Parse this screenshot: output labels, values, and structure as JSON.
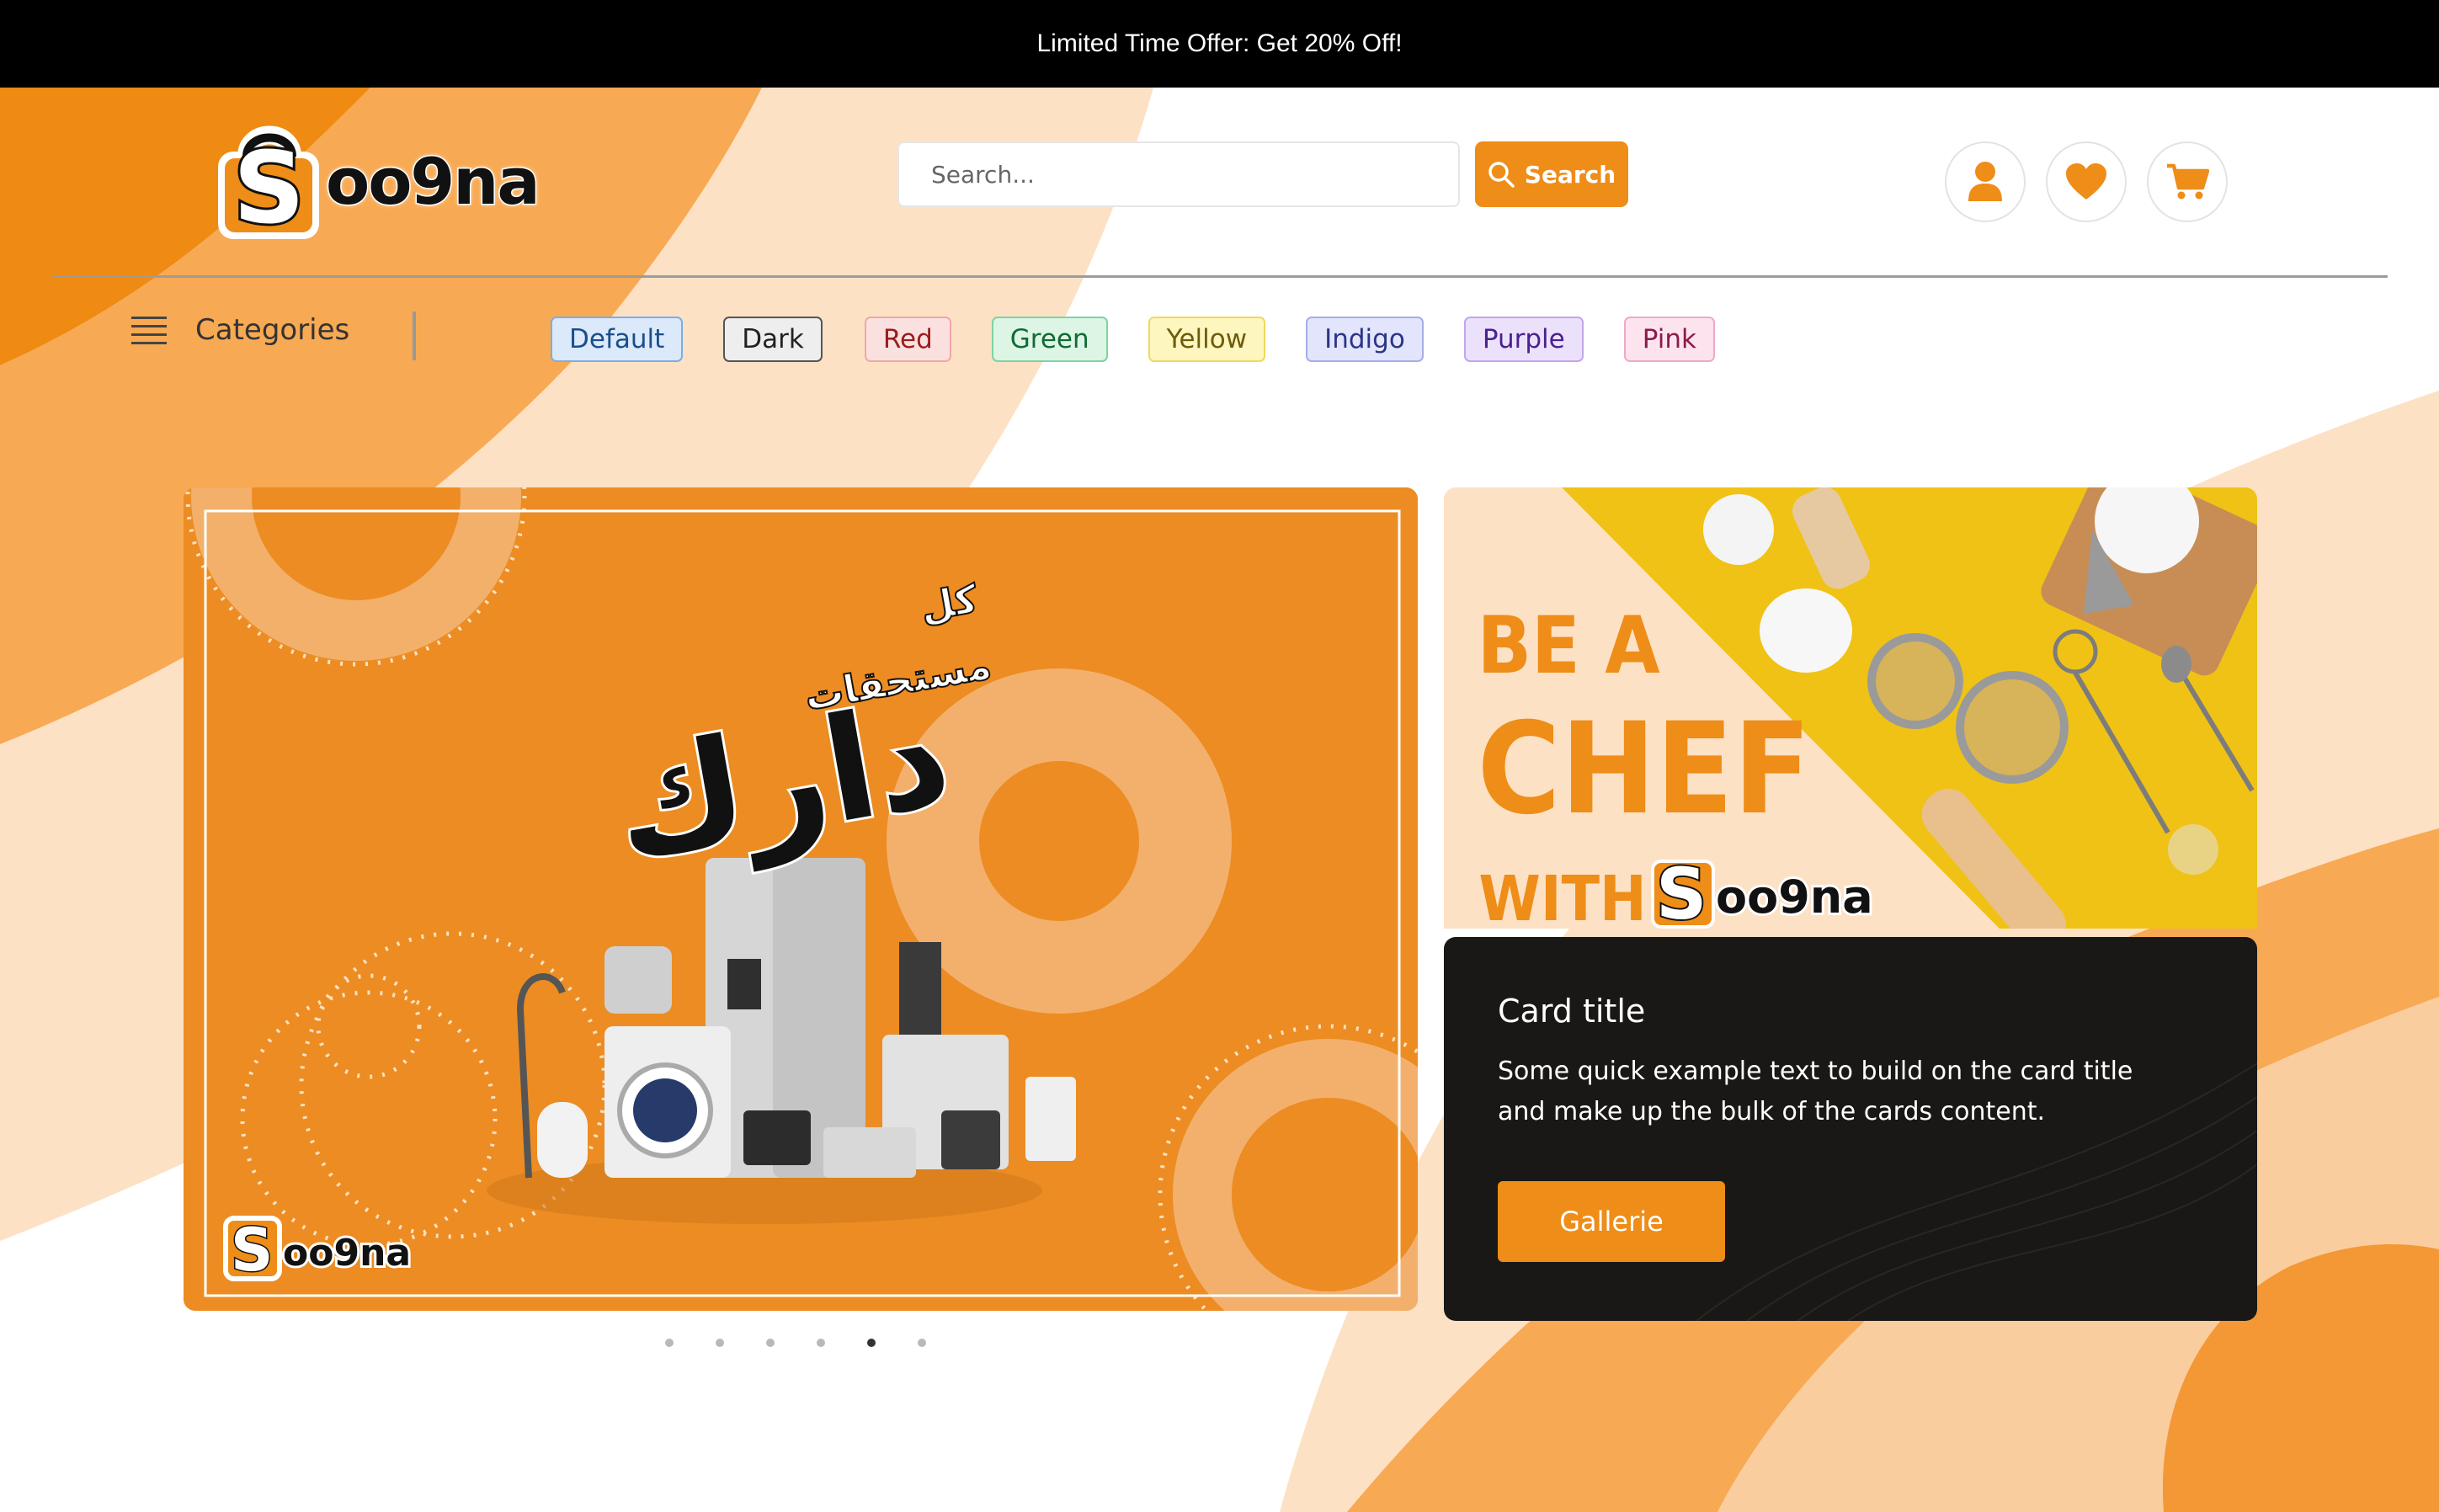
{
  "announcement": "Limited Time Offer: Get 20% Off!",
  "brand": {
    "logo_text": "oo9na",
    "logo_letter": "S"
  },
  "search": {
    "placeholder": "Search...",
    "button_label": "Search"
  },
  "header_icons": [
    "user-icon",
    "heart-icon",
    "cart-icon"
  ],
  "categories": {
    "label": "Categories"
  },
  "themes": [
    {
      "label": "Default",
      "bg": "#dbe9fb",
      "border": "#7aaee8",
      "color": "#1b4f8a"
    },
    {
      "label": "Dark",
      "bg": "#eeeeee",
      "border": "#555555",
      "color": "#222222"
    },
    {
      "label": "Red",
      "bg": "#fbe0e0",
      "border": "#f0a8a8",
      "color": "#9b1c1c"
    },
    {
      "label": "Green",
      "bg": "#dcf5e5",
      "border": "#7fd3a0",
      "color": "#116b35"
    },
    {
      "label": "Yellow",
      "bg": "#fdf6bf",
      "border": "#f1d95a",
      "color": "#6e5b0b"
    },
    {
      "label": "Indigo",
      "bg": "#e2e5fb",
      "border": "#a5adea",
      "color": "#2c3585"
    },
    {
      "label": "Purple",
      "bg": "#ece1fb",
      "border": "#c3a4ee",
      "color": "#4b2091"
    },
    {
      "label": "Pink",
      "bg": "#fce3ee",
      "border": "#f0a8c8",
      "color": "#8b1b4d"
    }
  ],
  "carousel": {
    "slide_text_line1": "كل",
    "slide_text_line2": "مستحقات",
    "slide_text_big": "دارك",
    "slide_logo": "oo9na",
    "active_index": 4,
    "dot_count": 6
  },
  "card": {
    "promo_line1": "BE A",
    "promo_line2": "CHEF",
    "promo_line3": "WITH",
    "promo_logo": "oo9na",
    "title": "Card title",
    "text": "Some quick example text to build on the card title and make up the bulk of the cards content.",
    "button_label": "Gallerie"
  },
  "colors": {
    "accent": "#ee8d18",
    "dark": "#1a1816"
  }
}
